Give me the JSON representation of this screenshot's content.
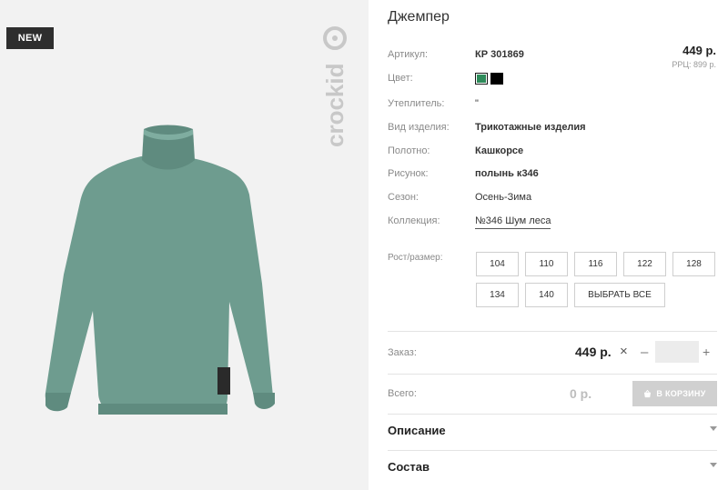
{
  "product": {
    "badge": "NEW",
    "brand": "crockid",
    "title": "Джемпер",
    "price": "449 р.",
    "rrp": "РРЦ: 899 р."
  },
  "attributes": {
    "article_label": "Артикул:",
    "article_value": "КР 301869",
    "color_label": "Цвет:",
    "colors": [
      "#2e8b5a",
      "#000000"
    ],
    "insulation_label": "Утеплитель:",
    "insulation_value": "\"",
    "type_label": "Вид изделия:",
    "type_value": "Трикотажные изделия",
    "fabric_label": "Полотно:",
    "fabric_value": "Кашкорсе",
    "pattern_label": "Рисунок:",
    "pattern_value": "полынь к346",
    "season_label": "Сезон:",
    "season_value": "Осень-Зима",
    "collection_label": "Коллекция:",
    "collection_value": "№346 Шум леса"
  },
  "sizes": {
    "label": "Рост/размер:",
    "options": [
      "104",
      "110",
      "116",
      "122",
      "128",
      "134",
      "140"
    ],
    "select_all": "ВЫБРАТЬ ВСЕ"
  },
  "order": {
    "label": "Заказ:",
    "price": "449 р.",
    "times": "×",
    "minus": "–",
    "plus": "+",
    "quantity": ""
  },
  "total": {
    "label": "Всего:",
    "value": "0 р.",
    "cart_button": "В КОРЗИНУ",
    "cart_icon": "basket-icon"
  },
  "sections": {
    "description": "Описание",
    "composition": "Состав"
  }
}
